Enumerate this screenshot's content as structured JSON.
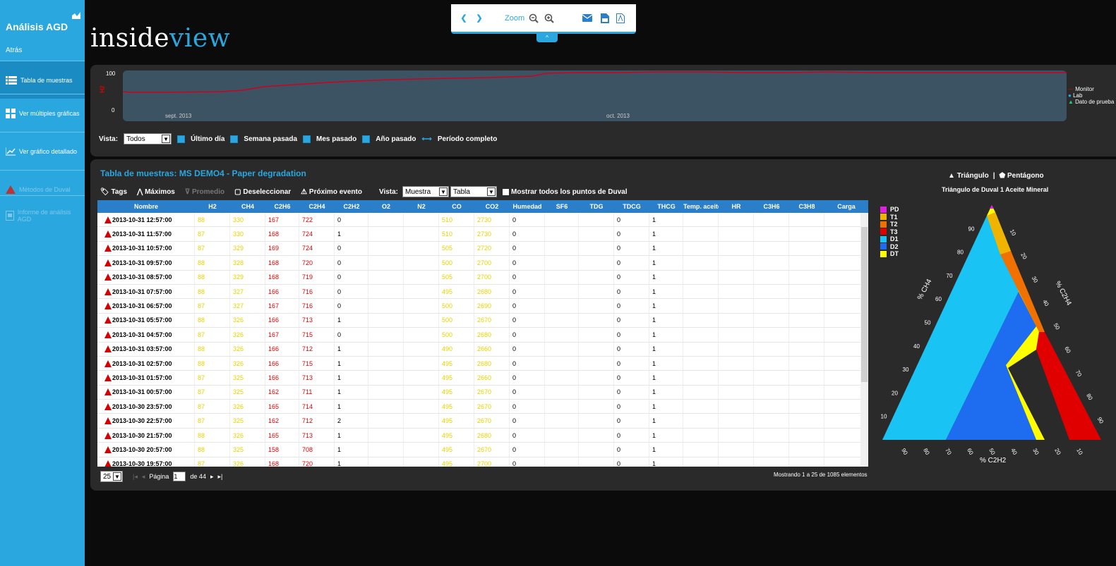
{
  "sidebar": {
    "title": "Análisis AGD",
    "back": "Atrás",
    "items": [
      {
        "label": "Tabla de muestras",
        "icon": "list-icon"
      },
      {
        "label": "Ver múltiples gráficas",
        "icon": "grid-icon"
      },
      {
        "label": "Ver gráfico detallado",
        "icon": "line-chart-icon"
      },
      {
        "label": "Métodos de Duval",
        "icon": "triangle-icon"
      },
      {
        "label": "Informe de análisis AGD",
        "icon": "report-icon"
      }
    ]
  },
  "logo": {
    "part1": "inside",
    "part2": "view"
  },
  "topbar": {
    "zoom": "Zoom",
    "collapse": "^"
  },
  "timeline": {
    "y_max": "100",
    "y_min": "0",
    "y_label": "H2",
    "x_labels": [
      "sept. 2013",
      "oct. 2013"
    ],
    "legend": [
      "Monitor",
      "Lab",
      "Dato de prueba"
    ]
  },
  "view_bar": {
    "label": "Vista:",
    "select": "Todos",
    "options": [
      "Último día",
      "Semana pasada",
      "Mes pasado",
      "Año pasado",
      "Período completo"
    ]
  },
  "panel": {
    "title": "Tabla de muestras: MS DEMO4 - Paper degradation",
    "toolbar": {
      "tags": "Tags",
      "maximos": "Máximos",
      "promedio": "Promedio",
      "deseleccionar": "Deseleccionar",
      "proximo": "Próximo evento",
      "vista_label": "Vista:",
      "vista_select": "Muestra",
      "tipo_select": "Tabla",
      "mostrar": "Mostrar todos los puntos de Duval"
    }
  },
  "table": {
    "columns": [
      "Nombre",
      "H2",
      "CH4",
      "C2H6",
      "C2H4",
      "C2H2",
      "O2",
      "N2",
      "CO",
      "CO2",
      "Humedad",
      "SF6",
      "TDG",
      "TDCG",
      "THCG",
      "Temp. aceite",
      "HR",
      "C3H6",
      "C3H8",
      "Carga"
    ],
    "rows": [
      [
        "2013-10-31 12:57:00",
        "88",
        "330",
        "167",
        "722",
        "0",
        "",
        "",
        "510",
        "2730",
        "0",
        "",
        "",
        "0",
        "1"
      ],
      [
        "2013-10-31 11:57:00",
        "87",
        "330",
        "168",
        "724",
        "1",
        "",
        "",
        "510",
        "2730",
        "0",
        "",
        "",
        "0",
        "1"
      ],
      [
        "2013-10-31 10:57:00",
        "87",
        "329",
        "169",
        "724",
        "0",
        "",
        "",
        "505",
        "2720",
        "0",
        "",
        "",
        "0",
        "1"
      ],
      [
        "2013-10-31 09:57:00",
        "88",
        "328",
        "168",
        "720",
        "0",
        "",
        "",
        "500",
        "2700",
        "0",
        "",
        "",
        "0",
        "1"
      ],
      [
        "2013-10-31 08:57:00",
        "88",
        "329",
        "168",
        "719",
        "0",
        "",
        "",
        "505",
        "2700",
        "0",
        "",
        "",
        "0",
        "1"
      ],
      [
        "2013-10-31 07:57:00",
        "88",
        "327",
        "166",
        "716",
        "0",
        "",
        "",
        "495",
        "2680",
        "0",
        "",
        "",
        "0",
        "1"
      ],
      [
        "2013-10-31 06:57:00",
        "87",
        "327",
        "167",
        "716",
        "0",
        "",
        "",
        "500",
        "2690",
        "0",
        "",
        "",
        "0",
        "1"
      ],
      [
        "2013-10-31 05:57:00",
        "88",
        "326",
        "166",
        "713",
        "1",
        "",
        "",
        "500",
        "2670",
        "0",
        "",
        "",
        "0",
        "1"
      ],
      [
        "2013-10-31 04:57:00",
        "87",
        "326",
        "167",
        "715",
        "0",
        "",
        "",
        "500",
        "2680",
        "0",
        "",
        "",
        "0",
        "1"
      ],
      [
        "2013-10-31 03:57:00",
        "88",
        "326",
        "166",
        "712",
        "1",
        "",
        "",
        "490",
        "2660",
        "0",
        "",
        "",
        "0",
        "1"
      ],
      [
        "2013-10-31 02:57:00",
        "88",
        "326",
        "166",
        "715",
        "1",
        "",
        "",
        "495",
        "2680",
        "0",
        "",
        "",
        "0",
        "1"
      ],
      [
        "2013-10-31 01:57:00",
        "87",
        "325",
        "166",
        "713",
        "1",
        "",
        "",
        "495",
        "2660",
        "0",
        "",
        "",
        "0",
        "1"
      ],
      [
        "2013-10-31 00:57:00",
        "87",
        "325",
        "162",
        "711",
        "1",
        "",
        "",
        "495",
        "2670",
        "0",
        "",
        "",
        "0",
        "1"
      ],
      [
        "2013-10-30 23:57:00",
        "87",
        "326",
        "165",
        "714",
        "1",
        "",
        "",
        "495",
        "2670",
        "0",
        "",
        "",
        "0",
        "1"
      ],
      [
        "2013-10-30 22:57:00",
        "87",
        "325",
        "162",
        "712",
        "2",
        "",
        "",
        "495",
        "2670",
        "0",
        "",
        "",
        "0",
        "1"
      ],
      [
        "2013-10-30 21:57:00",
        "88",
        "326",
        "165",
        "713",
        "1",
        "",
        "",
        "495",
        "2680",
        "0",
        "",
        "",
        "0",
        "1"
      ],
      [
        "2013-10-30 20:57:00",
        "88",
        "325",
        "158",
        "708",
        "1",
        "",
        "",
        "495",
        "2670",
        "0",
        "",
        "",
        "0",
        "1"
      ],
      [
        "2013-10-30 19:57:00",
        "87",
        "326",
        "168",
        "720",
        "1",
        "",
        "",
        "495",
        "2700",
        "0",
        "",
        "",
        "0",
        "1"
      ]
    ]
  },
  "pager": {
    "size": "25",
    "page_label": "Página",
    "page": "1",
    "of": "de 44",
    "status": "Mostrando 1 a 25 de 1085 elementos"
  },
  "duval": {
    "triangle": "Triángulo",
    "sep": "|",
    "pentagon": "Pentágono",
    "subtitle": "Triángulo de Duval 1 Aceite Mineral",
    "legend": [
      {
        "label": "PD",
        "color": "#e020e0"
      },
      {
        "label": "T1",
        "color": "#f0b400"
      },
      {
        "label": "T2",
        "color": "#f07000"
      },
      {
        "label": "T3",
        "color": "#e00000"
      },
      {
        "label": "D1",
        "color": "#19c4f5"
      },
      {
        "label": "D2",
        "color": "#1e6cf0"
      },
      {
        "label": "DT",
        "color": "#ffff00"
      }
    ],
    "axis_ch4": "% CH4",
    "axis_c2h4": "% C2H4",
    "axis_c2h2": "% C2H2",
    "left_ticks": [
      "90",
      "80",
      "70",
      "60",
      "50",
      "40",
      "30",
      "20",
      "10"
    ],
    "right_ticks": [
      "10",
      "20",
      "30",
      "40",
      "50",
      "60",
      "70",
      "80",
      "90"
    ],
    "bottom_ticks": [
      "90",
      "80",
      "70",
      "60",
      "50",
      "40",
      "30",
      "20",
      "10"
    ]
  }
}
